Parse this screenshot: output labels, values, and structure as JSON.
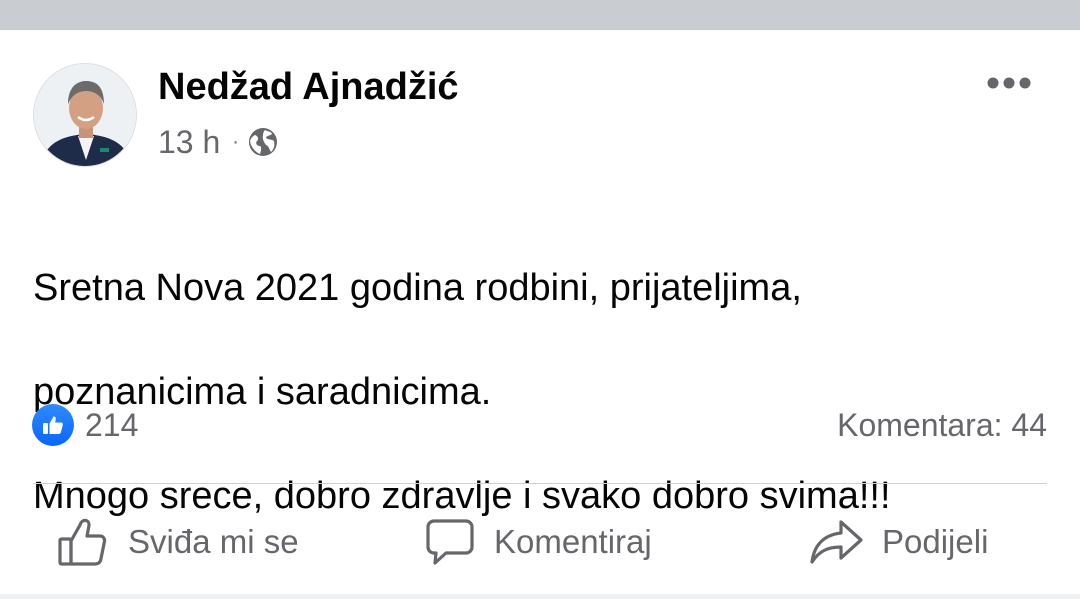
{
  "post": {
    "author": "Nedžad Ajnadžić",
    "time": "13 h",
    "separator": "·",
    "audience_icon": "globe-icon",
    "more_icon": "more-options-icon",
    "text_lines": [
      "Sretna Nova 2021 godina rodbini, prijateljima,",
      "poznanicima i saradnicima.",
      "Mnogo srece, dobro zdravlje i svako dobro svima!!!"
    ]
  },
  "stats": {
    "reaction_icon": "like-reaction-icon",
    "reaction_count": "214",
    "comments_label": "Komentara: 44"
  },
  "actions": {
    "like_label": "Sviđa mi se",
    "comment_label": "Komentiraj",
    "share_label": "Podijeli"
  },
  "colors": {
    "accent": "#1877f2",
    "secondary_text": "#65676b",
    "primary_text": "#050505",
    "divider": "#ced0d4"
  }
}
